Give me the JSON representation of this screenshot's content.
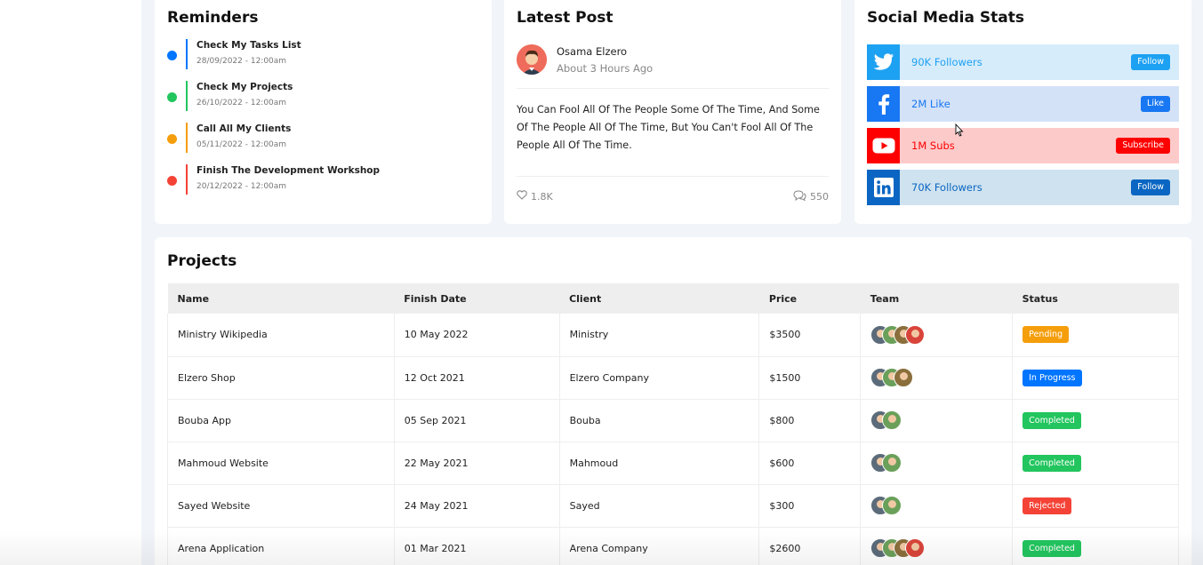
{
  "reminders": {
    "title": "Reminders",
    "items": [
      {
        "title": "Check My Tasks List",
        "date": "28/09/2022 - 12:00am",
        "color": "#0075ff"
      },
      {
        "title": "Check My Projects",
        "date": "26/10/2022 - 12:00am",
        "color": "#22c55e"
      },
      {
        "title": "Call All My Clients",
        "date": "05/11/2022 - 12:00am",
        "color": "#f59e0b"
      },
      {
        "title": "Finish The Development Workshop",
        "date": "20/12/2022 - 12:00am",
        "color": "#f44336"
      }
    ]
  },
  "latest_post": {
    "title": "Latest Post",
    "author": "Osama Elzero",
    "time": "About 3 Hours Ago",
    "body": "You Can Fool All Of The People Some Of The Time, And Some Of The People All Of The Time, But You Can't Fool All Of The People All Of The Time.",
    "likes": "1.8K",
    "comments": "550"
  },
  "social": {
    "title": "Social Media Stats",
    "items": [
      {
        "network": "twitter",
        "text": "90K Followers",
        "button": "Follow",
        "bg": "#d6ecfb",
        "icon_bg": "#1da1f2",
        "text_color": "#1da1f2",
        "button_bg": "#1da1f2"
      },
      {
        "network": "facebook",
        "text": "2M Like",
        "button": "Like",
        "bg": "#d4e2f8",
        "icon_bg": "#1877f2",
        "text_color": "#1877f2",
        "button_bg": "#1877f2"
      },
      {
        "network": "youtube",
        "text": "1M Subs",
        "button": "Subscribe",
        "bg": "#fdcaca",
        "icon_bg": "#ff0000",
        "text_color": "#ff0000",
        "button_bg": "#ff0000"
      },
      {
        "network": "linkedin",
        "text": "70K Followers",
        "button": "Follow",
        "bg": "#cfe2ef",
        "icon_bg": "#0a66c2",
        "text_color": "#0a66c2",
        "button_bg": "#0a66c2"
      }
    ]
  },
  "projects": {
    "title": "Projects",
    "columns": [
      "Name",
      "Finish Date",
      "Client",
      "Price",
      "Team",
      "Status"
    ],
    "rows": [
      {
        "name": "Ministry Wikipedia",
        "date": "10 May 2022",
        "client": "Ministry",
        "price": "$3500",
        "team_size": 4,
        "status": "Pending",
        "status_color": "#f59e0b"
      },
      {
        "name": "Elzero Shop",
        "date": "12 Oct 2021",
        "client": "Elzero Company",
        "price": "$1500",
        "team_size": 3,
        "status": "In Progress",
        "status_color": "#0075ff"
      },
      {
        "name": "Bouba App",
        "date": "05 Sep 2021",
        "client": "Bouba",
        "price": "$800",
        "team_size": 2,
        "status": "Completed",
        "status_color": "#22c55e"
      },
      {
        "name": "Mahmoud Website",
        "date": "22 May 2021",
        "client": "Mahmoud",
        "price": "$600",
        "team_size": 2,
        "status": "Completed",
        "status_color": "#22c55e"
      },
      {
        "name": "Sayed Website",
        "date": "24 May 2021",
        "client": "Sayed",
        "price": "$300",
        "team_size": 2,
        "status": "Rejected",
        "status_color": "#f44336"
      },
      {
        "name": "Arena Application",
        "date": "01 Mar 2021",
        "client": "Arena Company",
        "price": "$2600",
        "team_size": 4,
        "status": "Completed",
        "status_color": "#22c55e"
      }
    ]
  }
}
